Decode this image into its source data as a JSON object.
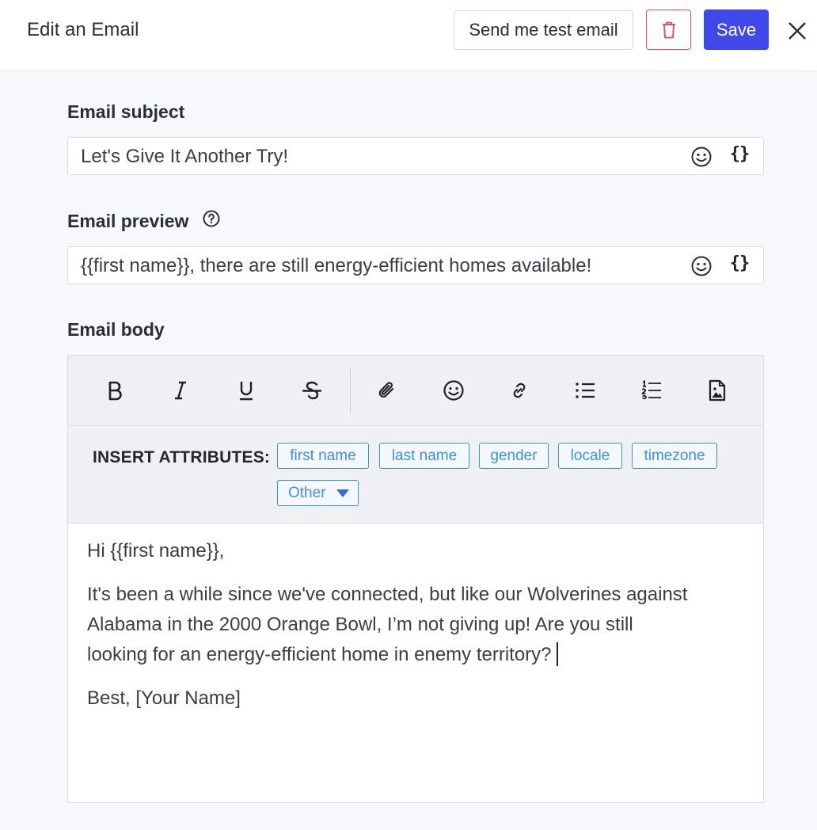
{
  "header": {
    "title": "Edit an Email",
    "test_email_label": "Send me test email",
    "save_label": "Save"
  },
  "subject": {
    "label": "Email subject",
    "value": "Let's Give It Another Try!"
  },
  "preview": {
    "label": "Email preview",
    "value": "{{first name}}, there are still energy-efficient homes available!"
  },
  "field_tools": {
    "braces": "{}"
  },
  "body": {
    "label": "Email body",
    "toolbar": [
      "bold-icon",
      "italic-icon",
      "underline-icon",
      "strikethrough-icon",
      "attachment-icon",
      "emoji-icon",
      "link-icon",
      "bulleted-list-icon",
      "numbered-list-icon",
      "file-image-icon"
    ],
    "attributes_label": "INSERT ATTRIBUTES:",
    "attributes": [
      "first name",
      "last name",
      "gender",
      "locale",
      "timezone"
    ],
    "other_label": "Other",
    "content": {
      "greeting": "Hi {{first name}},",
      "paragraph_lines": [
        "It's been a while since we've connected, but like our Wolverines against",
        "Alabama in the 2000 Orange Bowl, I’m not giving up! Are you still",
        "looking for an energy-efficient home in enemy territory?"
      ],
      "signoff": "Best, [Your Name]"
    }
  },
  "colors": {
    "primary": "#4148ea",
    "danger": "#e05560",
    "chip": "#3d8fe0",
    "background": "#f7f8fb"
  }
}
